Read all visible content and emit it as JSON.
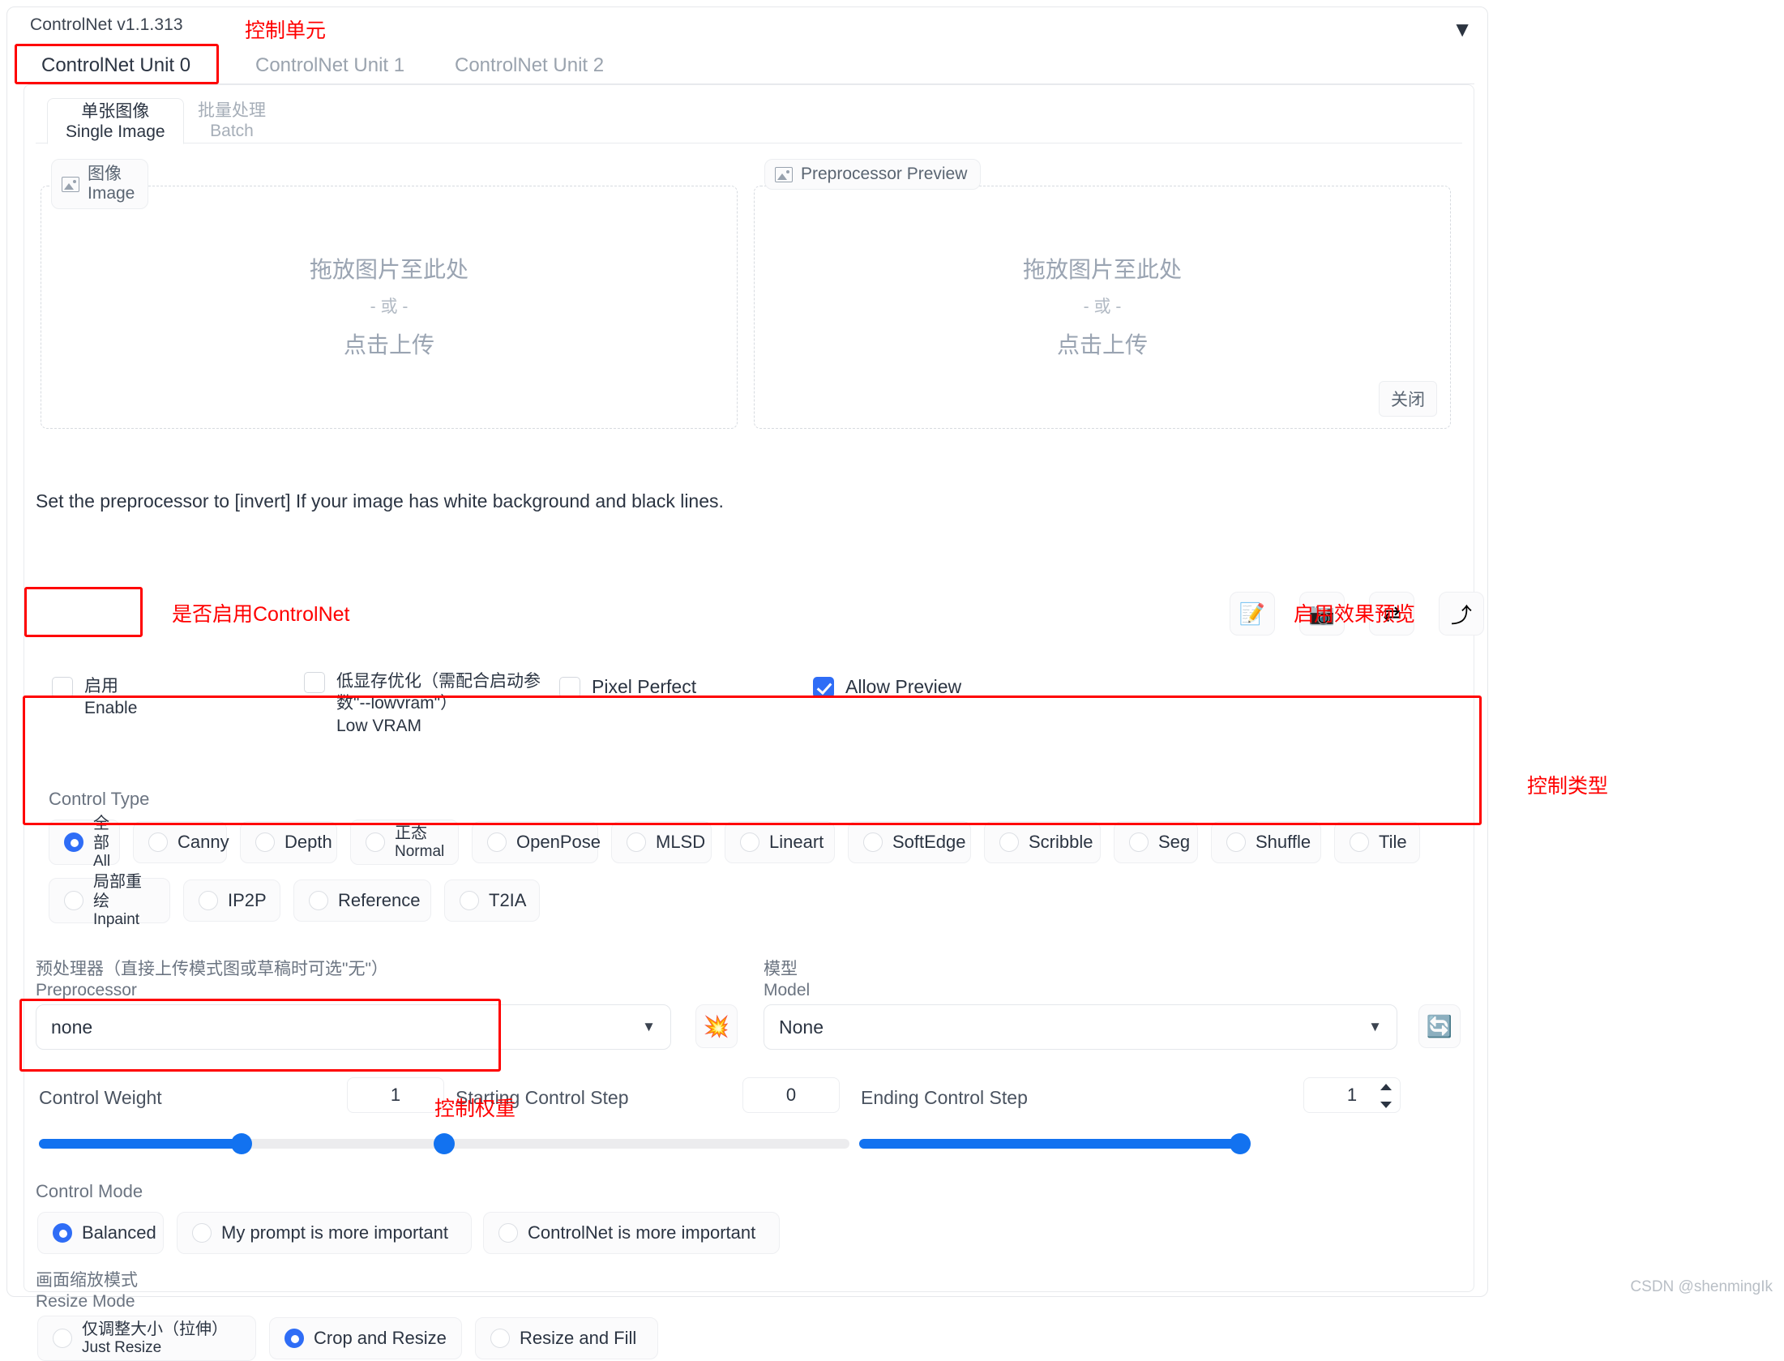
{
  "panel": {
    "version": "ControlNet v1.1.313",
    "caret": "▼"
  },
  "annotations": {
    "unit": "控制单元",
    "enable": "是否启用ControlNet",
    "preview": "启用效果预览",
    "control_type": "控制类型",
    "control_weight": "控制权重"
  },
  "unit_tabs": [
    {
      "label": "ControlNet Unit 0",
      "active": true
    },
    {
      "label": "ControlNet Unit 1",
      "active": false
    },
    {
      "label": "ControlNet Unit 2",
      "active": false
    }
  ],
  "sub_tabs": [
    {
      "cn": "单张图像",
      "en": "Single Image",
      "active": true
    },
    {
      "cn": "批量处理",
      "en": "Batch",
      "active": false
    }
  ],
  "drop_left": {
    "chip_cn": "图像",
    "chip_en": "Image",
    "line1": "拖放图片至此处",
    "line2": "- 或 -",
    "line3": "点击上传"
  },
  "drop_right": {
    "chip": "Preprocessor Preview",
    "line1": "拖放图片至此处",
    "line2": "- 或 -",
    "line3": "点击上传",
    "close": "关闭"
  },
  "hint": "Set the preprocessor to [invert] If your image has white background and black lines.",
  "toolbar": [
    {
      "name": "edit-icon",
      "glyph": "📝"
    },
    {
      "name": "camera-icon",
      "glyph": "📷"
    },
    {
      "name": "swap-icon",
      "glyph": "⇄"
    },
    {
      "name": "undo-icon",
      "glyph": "⤴"
    }
  ],
  "checkboxes": [
    {
      "cn": "启用",
      "en": "Enable",
      "checked": false
    },
    {
      "cn": "低显存优化（需配合启动参数\"--lowvram\"）",
      "en": "Low VRAM",
      "checked": false
    },
    {
      "one": "Pixel Perfect",
      "checked": false
    },
    {
      "one": "Allow Preview",
      "checked": true
    }
  ],
  "control_type": {
    "title": "Control Type",
    "options": [
      {
        "cn": "全部",
        "en": "All",
        "selected": true
      },
      {
        "one": "Canny",
        "selected": false
      },
      {
        "one": "Depth",
        "selected": false
      },
      {
        "cn": "正态",
        "en": "Normal",
        "selected": false
      },
      {
        "one": "OpenPose",
        "selected": false
      },
      {
        "one": "MLSD",
        "selected": false
      },
      {
        "one": "Lineart",
        "selected": false
      },
      {
        "one": "SoftEdge",
        "selected": false
      },
      {
        "one": "Scribble",
        "selected": false
      },
      {
        "one": "Seg",
        "selected": false
      },
      {
        "one": "Shuffle",
        "selected": false
      },
      {
        "one": "Tile",
        "selected": false
      },
      {
        "cn": "局部重绘",
        "en": "Inpaint",
        "selected": false
      },
      {
        "one": "IP2P",
        "selected": false
      },
      {
        "one": "Reference",
        "selected": false
      },
      {
        "one": "T2IA",
        "selected": false
      }
    ]
  },
  "preprocessor": {
    "label_cn": "预处理器（直接上传模式图或草稿时可选\"无\"）",
    "label_en": "Preprocessor",
    "value": "none",
    "caret": "▼",
    "run_icon": "💥"
  },
  "model": {
    "label_cn": "模型",
    "label_en": "Model",
    "value": "None",
    "caret": "▼",
    "refresh_icon": "🔄"
  },
  "sliders": {
    "control_weight": {
      "label": "Control Weight",
      "value": "1",
      "percent": 50
    },
    "starting_step": {
      "label": "Starting Control Step",
      "value": "0",
      "percent": 0
    },
    "ending_step": {
      "label": "Ending Control Step",
      "value": "1",
      "percent": 100
    }
  },
  "control_mode": {
    "title": "Control Mode",
    "options": [
      {
        "one": "Balanced",
        "selected": true
      },
      {
        "one": "My prompt is more important",
        "selected": false
      },
      {
        "one": "ControlNet is more important",
        "selected": false
      }
    ]
  },
  "resize_mode": {
    "title_cn": "画面缩放模式",
    "title_en": "Resize Mode",
    "options": [
      {
        "cn": "仅调整大小（拉伸）",
        "en": "Just Resize",
        "selected": false
      },
      {
        "one": "Crop and Resize",
        "selected": true
      },
      {
        "one": "Resize and Fill",
        "selected": false
      }
    ]
  },
  "watermark": "CSDN @shenmingIk",
  "colors": {
    "accent": "#1272f0",
    "annotation": "#ff0000",
    "text": "#2b3442",
    "muted": "#9aa4b2"
  }
}
